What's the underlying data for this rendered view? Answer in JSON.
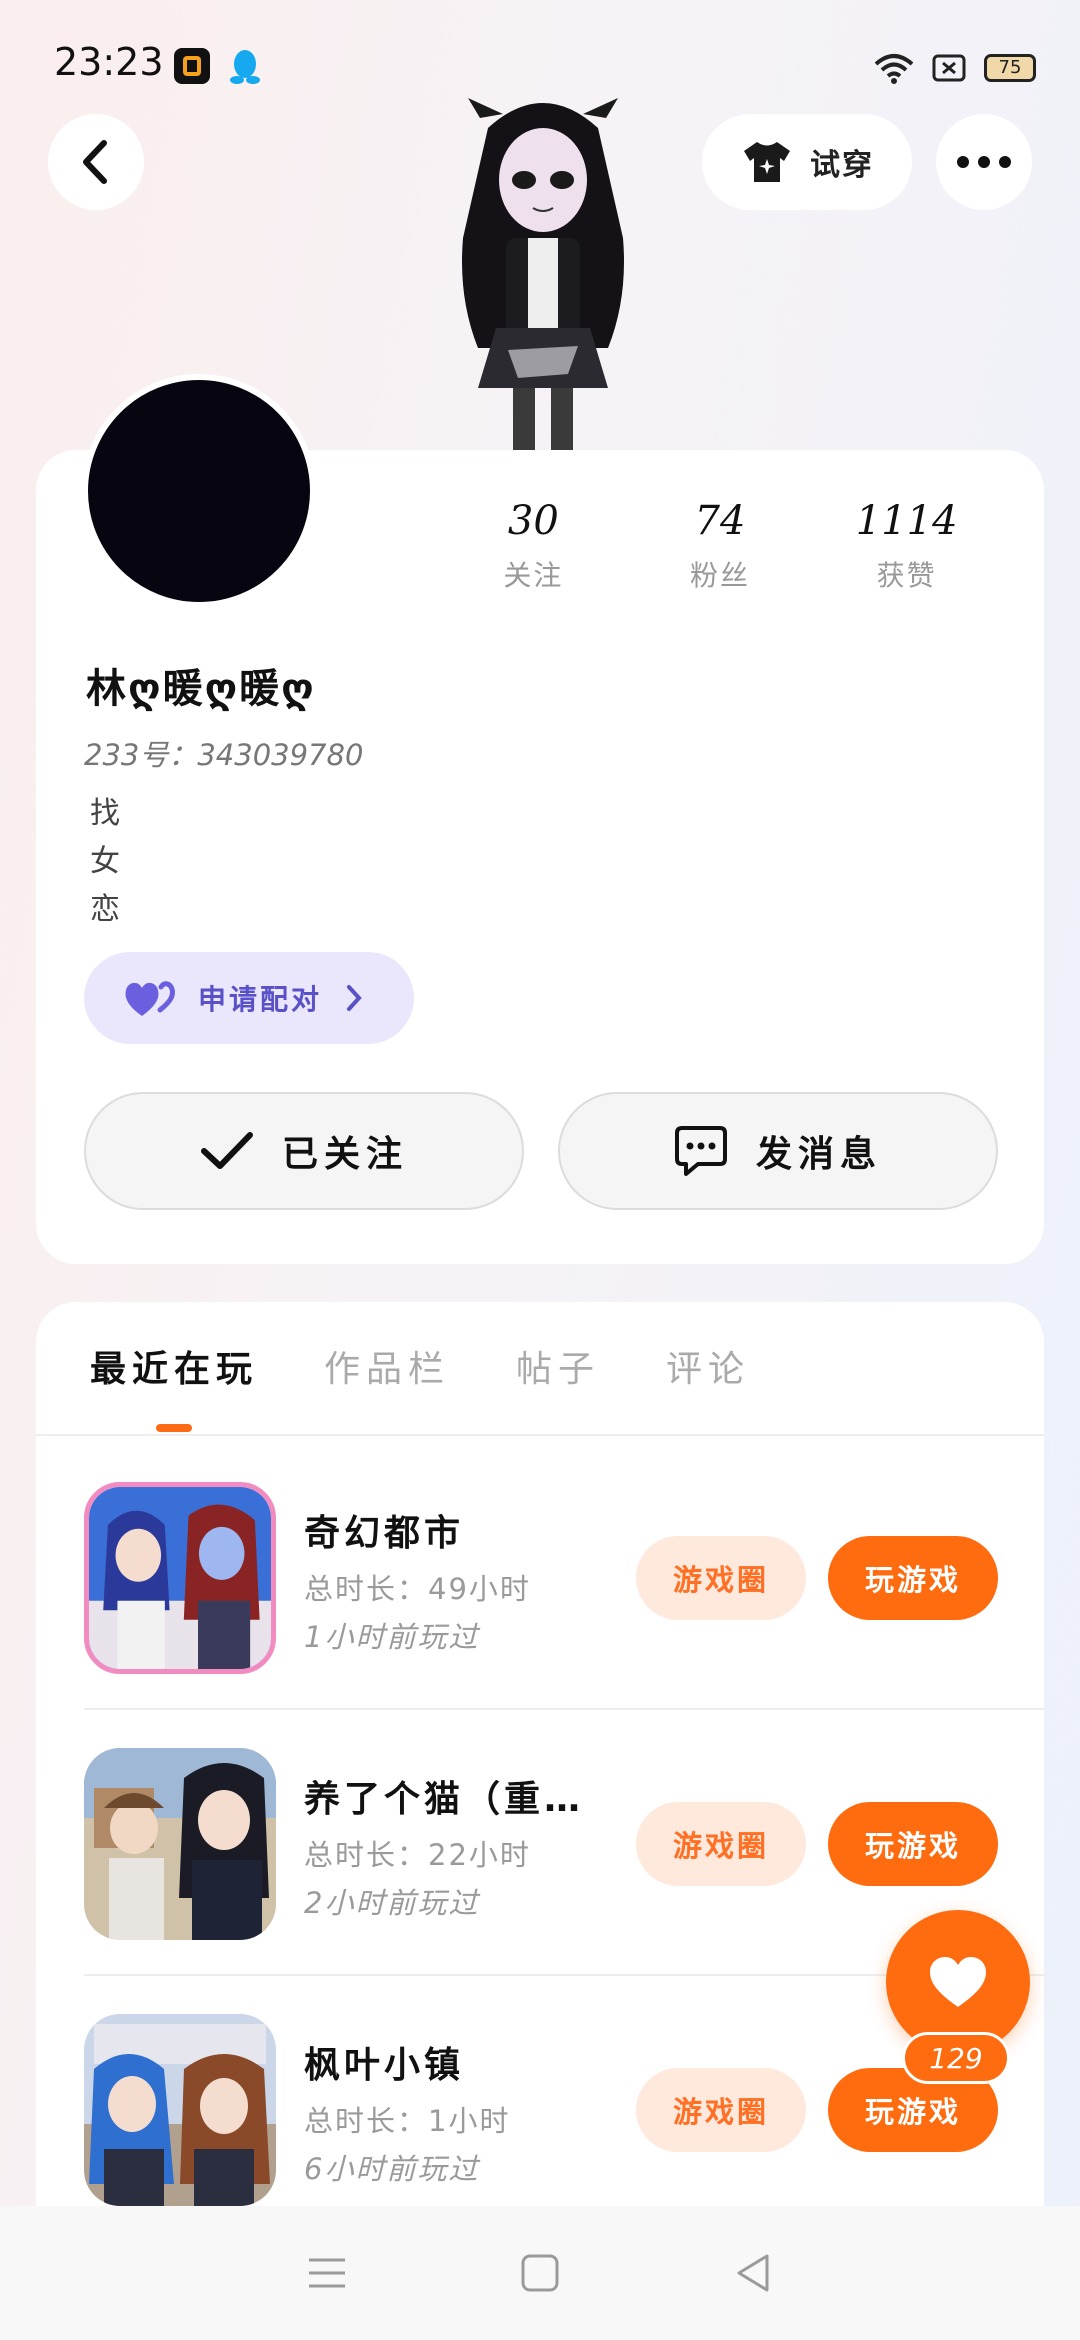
{
  "status_bar": {
    "time": "23:23",
    "battery": "75"
  },
  "header": {
    "tryon_label": "试穿"
  },
  "profile": {
    "stats": [
      {
        "value": "30",
        "label": "关注"
      },
      {
        "value": "74",
        "label": "粉丝"
      },
      {
        "value": "1114",
        "label": "获赞"
      }
    ],
    "nickname": "林ღ暖ღ暖ღ",
    "uid": "233号：343039780",
    "bio": [
      "找",
      "女",
      "恋"
    ],
    "pair_label": "申请配对",
    "follow_label": "已关注",
    "message_label": "发消息"
  },
  "tabs": [
    "最近在玩",
    "作品栏",
    "帖子",
    "评论"
  ],
  "games": [
    {
      "title": "奇幻都市",
      "duration": "总时长：49小时",
      "last_played": "1小时前玩过",
      "circle_label": "游戏圈",
      "play_label": "玩游戏"
    },
    {
      "title": "养了个猫（重…",
      "duration": "总时长：22小时",
      "last_played": "2小时前玩过",
      "circle_label": "游戏圈",
      "play_label": "玩游戏"
    },
    {
      "title": "枫叶小镇",
      "duration": "总时长：1小时",
      "last_played": "6小时前玩过",
      "circle_label": "游戏圈",
      "play_label": "玩游戏"
    }
  ],
  "float_like": {
    "count": "129"
  },
  "colors": {
    "accent": "#ff6b0f",
    "accent_light": "#ffe9dc",
    "pair_bg": "#eae7fc",
    "pair_text": "#5a50c8"
  }
}
